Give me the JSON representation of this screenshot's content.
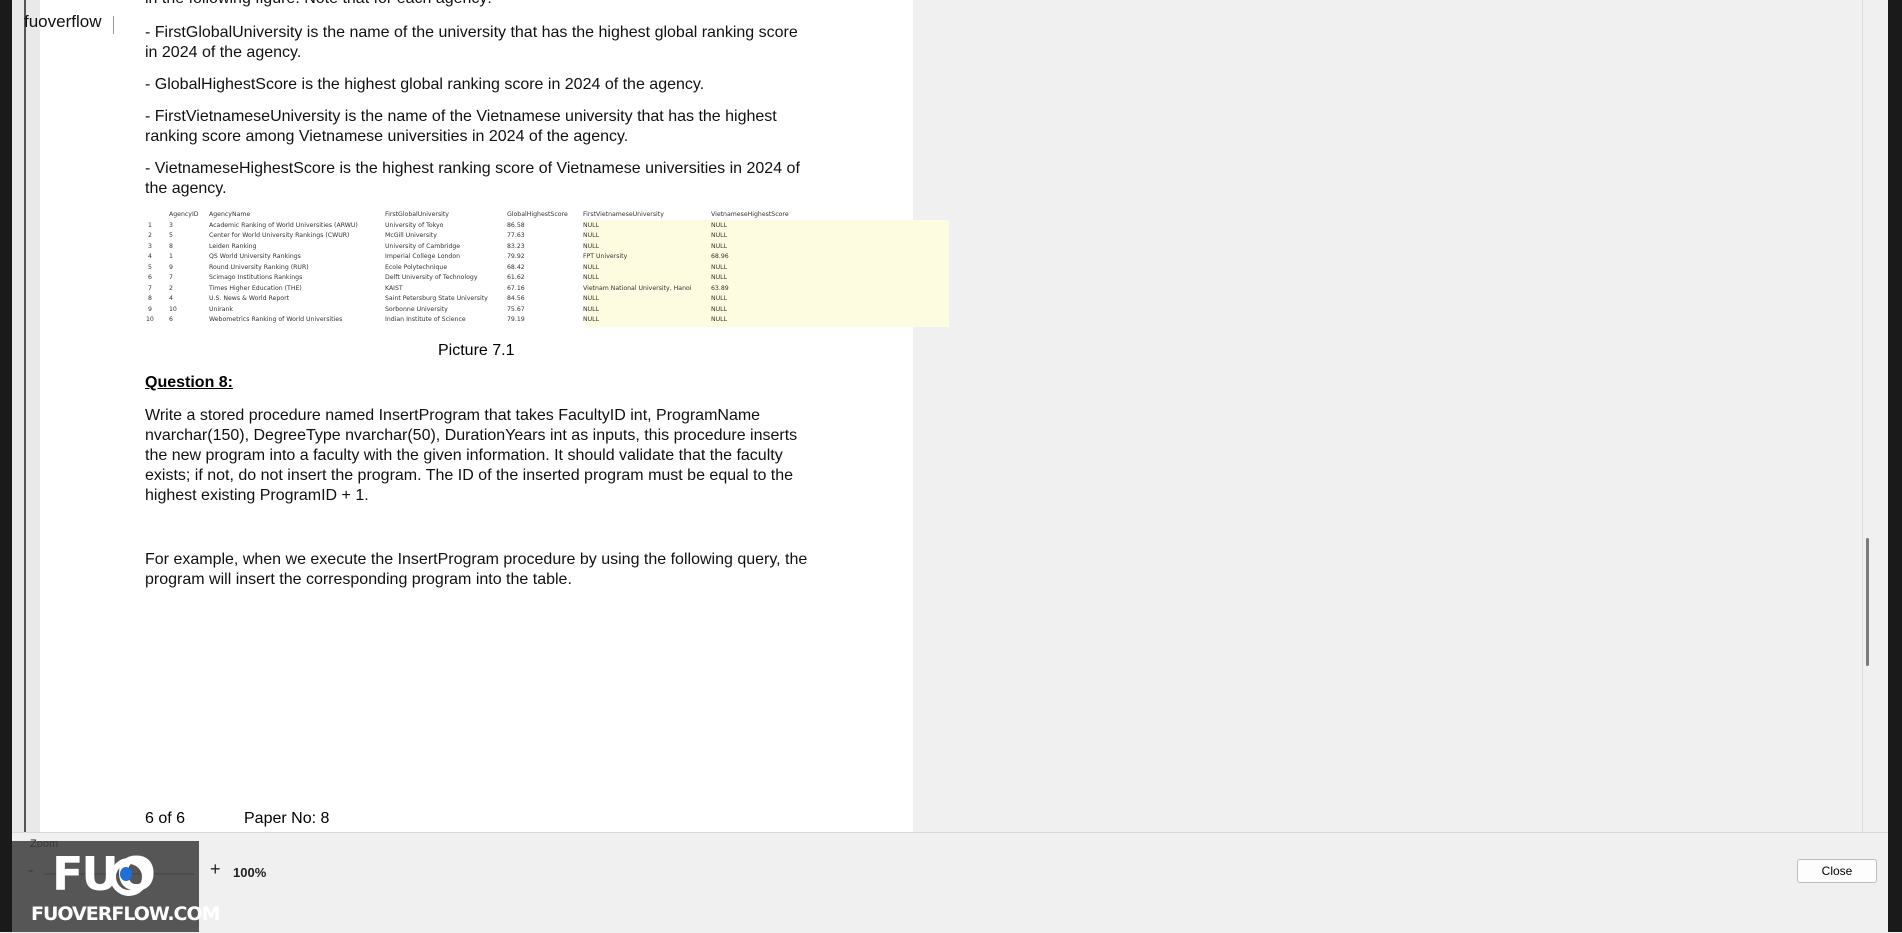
{
  "app": {
    "title": "fuoverflow"
  },
  "document": {
    "cut_line": "in the following figure. Note that for each agency:",
    "bullets": [
      "- FirstGlobalUniversity is the name of the university that has the highest global ranking score in 2024 of the agency.",
      "- GlobalHighestScore is the highest global ranking score in 2024 of the agency.",
      "- FirstVietnameseUniversity is the name of the Vietnamese university that has the highest ranking score among Vietnamese universities in 2024 of the agency.",
      "- VietnameseHighestScore is the highest ranking score of Vietnamese universities in 2024 of the agency."
    ],
    "table": {
      "headers": [
        "",
        "AgencyID",
        "AgencyName",
        "FirstGlobalUniversity",
        "GlobalHighestScore",
        "FirstVietnameseUniversity",
        "VietnameseHighestScore"
      ],
      "rows": [
        [
          "1",
          "3",
          "Academic Ranking of World Universities (ARWU)",
          "University of Tokyo",
          "86.58",
          "NULL",
          "NULL"
        ],
        [
          "2",
          "5",
          "Center for World University Rankings (CWUR)",
          "McGill University",
          "77.63",
          "NULL",
          "NULL"
        ],
        [
          "3",
          "8",
          "Leiden Ranking",
          "University of Cambridge",
          "83.23",
          "NULL",
          "NULL"
        ],
        [
          "4",
          "1",
          "QS World University Rankings",
          "Imperial College London",
          "79.92",
          "FPT University",
          "68.96"
        ],
        [
          "5",
          "9",
          "Round University Ranking (RUR)",
          "École Polytechnique",
          "68.42",
          "NULL",
          "NULL"
        ],
        [
          "6",
          "7",
          "Scimago Institutions Rankings",
          "Delft University of Technology",
          "61.62",
          "NULL",
          "NULL"
        ],
        [
          "7",
          "2",
          "Times Higher Education (THE)",
          "KAIST",
          "67.16",
          "Vietnam National University, Hanoi",
          "63.89"
        ],
        [
          "8",
          "4",
          "U.S. News & World Report",
          "Saint Petersburg State University",
          "84.56",
          "NULL",
          "NULL"
        ],
        [
          "9",
          "10",
          "Unirank",
          "Sorbonne University",
          "75.67",
          "NULL",
          "NULL"
        ],
        [
          "10",
          "6",
          "Webometrics Ranking of World Universities",
          "Indian Institute of Science",
          "79.19",
          "NULL",
          "NULL"
        ]
      ]
    },
    "caption": "Picture 7.1",
    "question_heading": "Question 8:",
    "question_body": "Write a stored procedure named InsertProgram that takes FacultyID int, ProgramName nvarchar(150), DegreeType nvarchar(50), DurationYears int as inputs, this procedure inserts the new program into a faculty with the given information. It should validate that the faculty exists; if not, do not insert the program. The ID of the inserted program must be equal to the highest existing ProgramID + 1.",
    "example": "For example, when we execute the InsertProgram procedure by using the following query, the program will insert the corresponding program into the table.",
    "page_indicator": "6 of 6",
    "paper_no": "Paper No: 8"
  },
  "bottom_bar": {
    "zoom_label": "Zoom",
    "zoom_minus": "-",
    "zoom_plus": "+",
    "zoom_value": "100%",
    "close_label": "Close"
  },
  "watermark": {
    "logo": "FUO",
    "site": "FUOVERFLOW.COM"
  }
}
